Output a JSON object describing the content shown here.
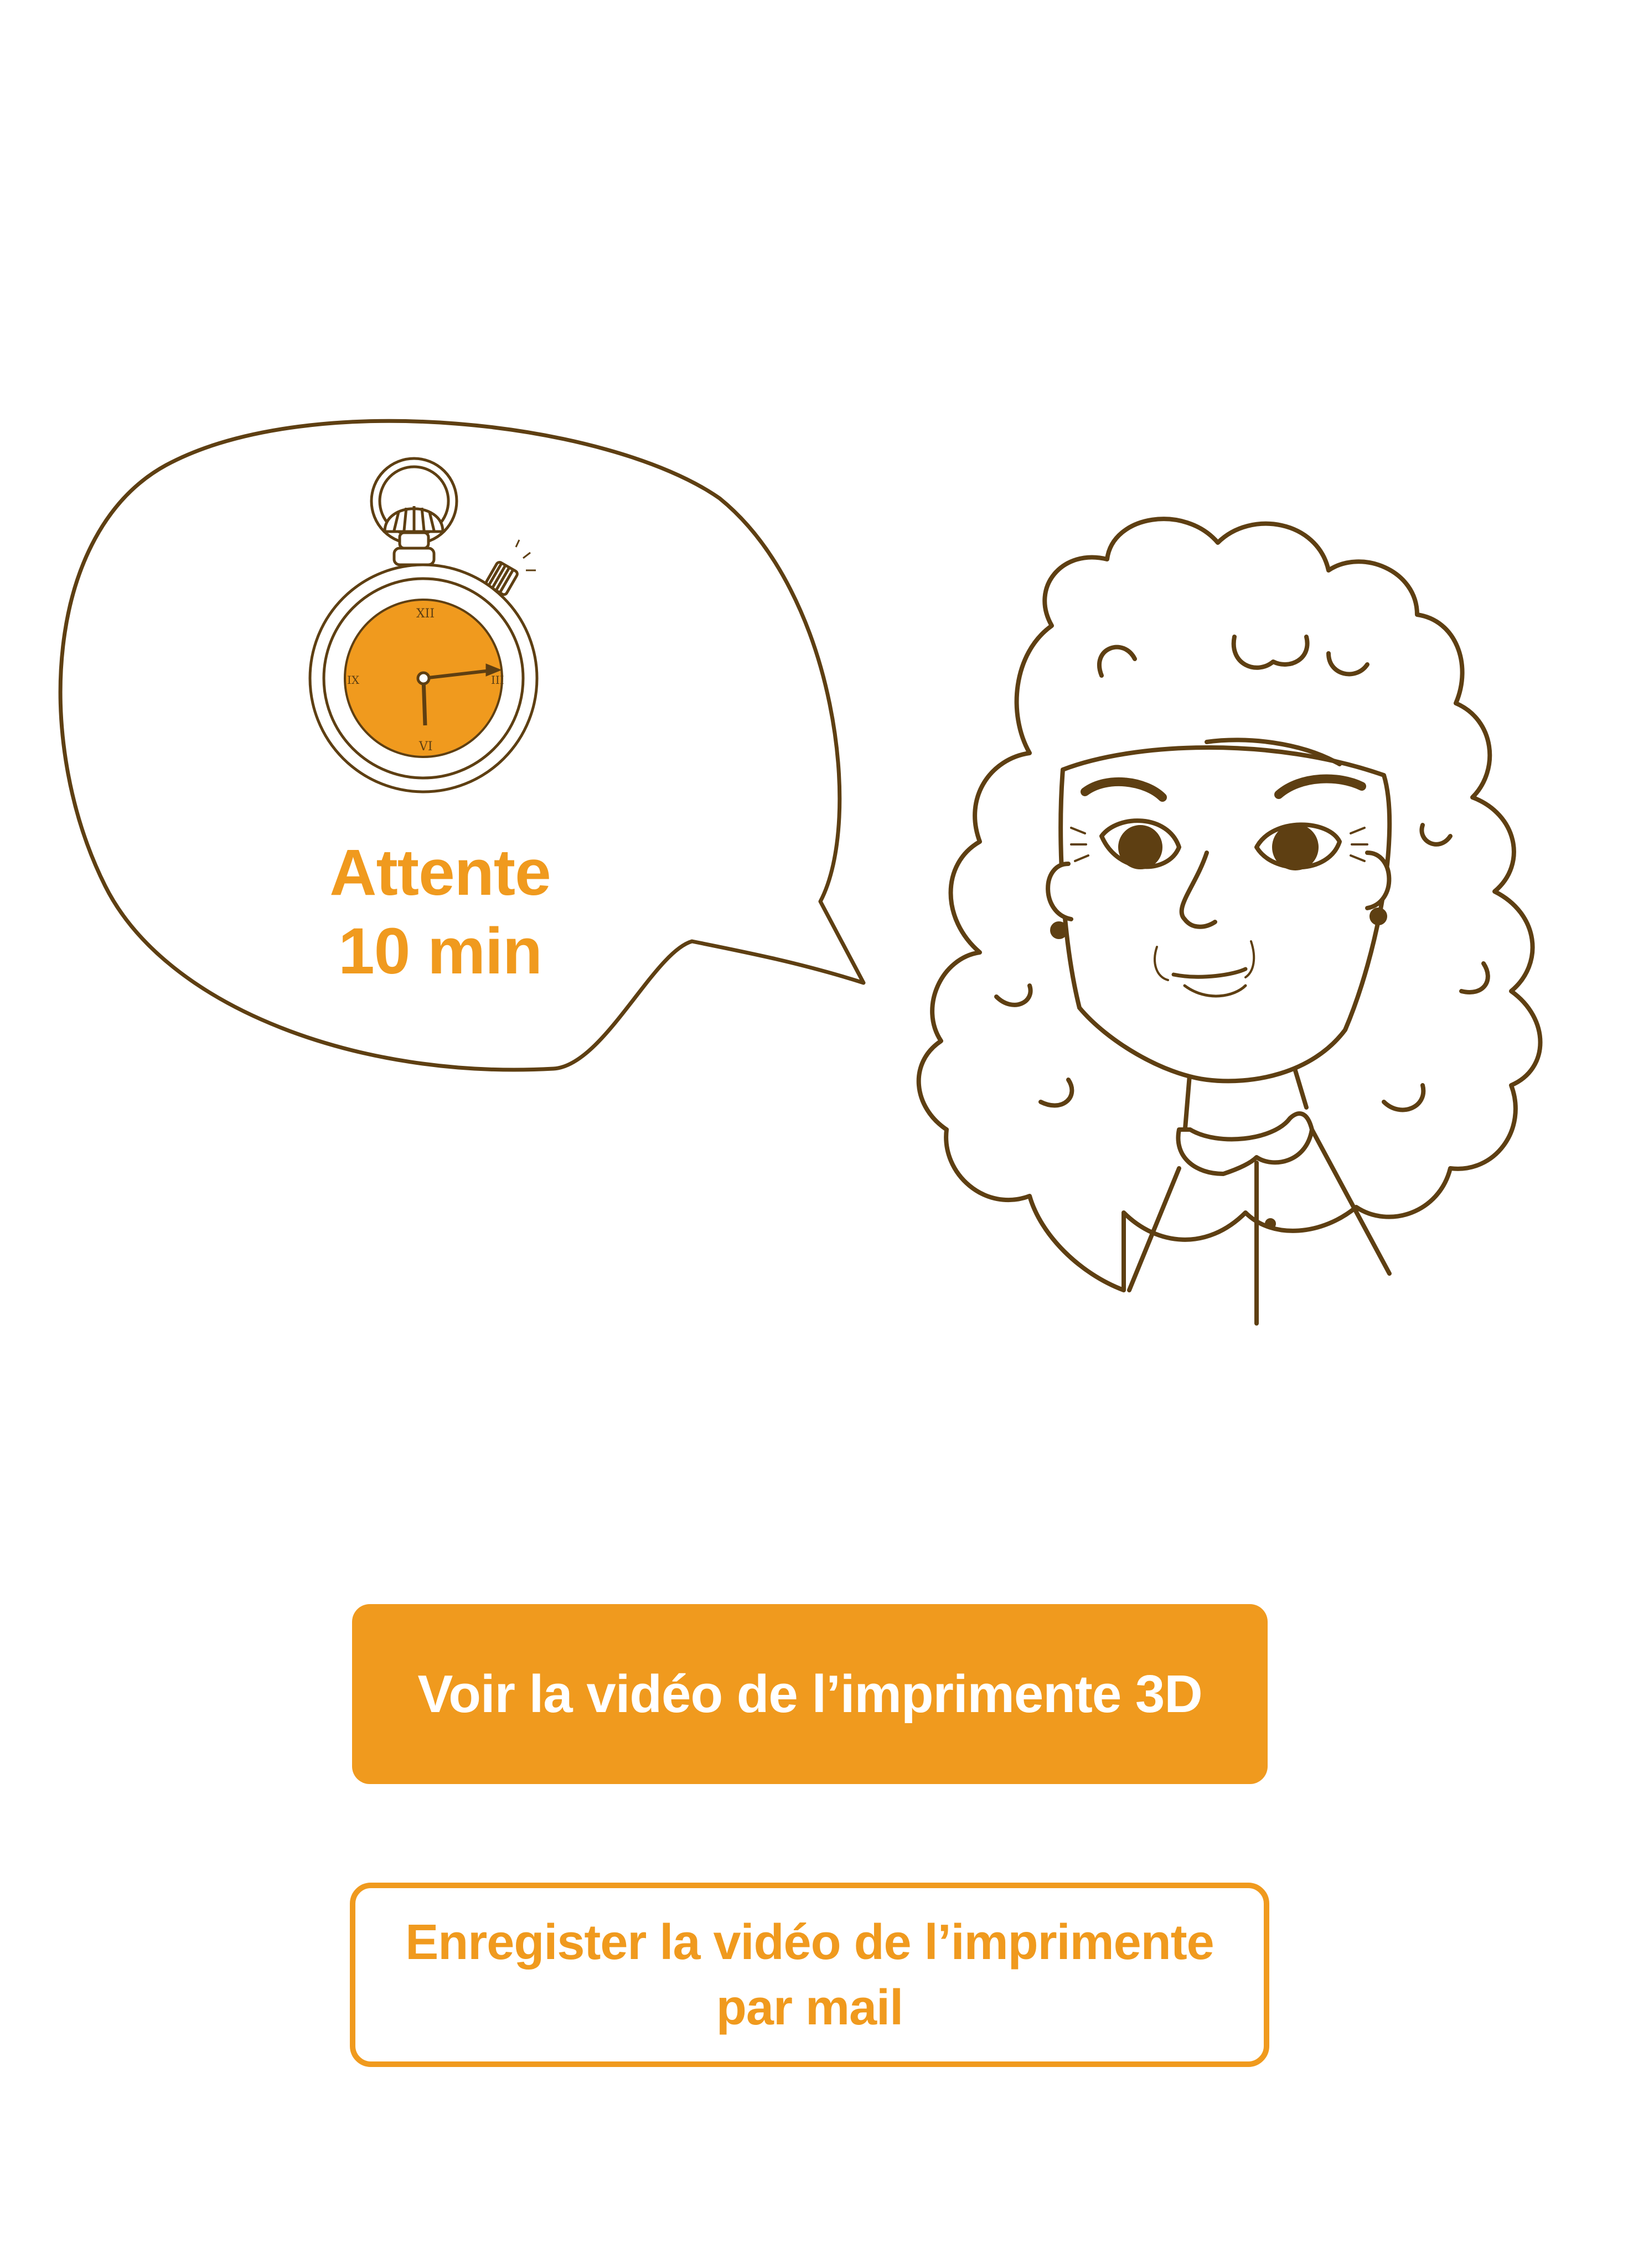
{
  "bubble": {
    "line1": "Attente",
    "line2": "10 min"
  },
  "buttons": {
    "primary_label": "Voir la vidéo de l’imprimente 3D",
    "secondary_line1": "Enregister la vidéo de l’imprimente",
    "secondary_line2": "par mail"
  },
  "icons": {
    "timer": "stopwatch-icon",
    "character": "woman-illustration"
  },
  "colors": {
    "accent": "#F09A1E",
    "line": "#5E3F12",
    "background": "#FFFFFF"
  }
}
